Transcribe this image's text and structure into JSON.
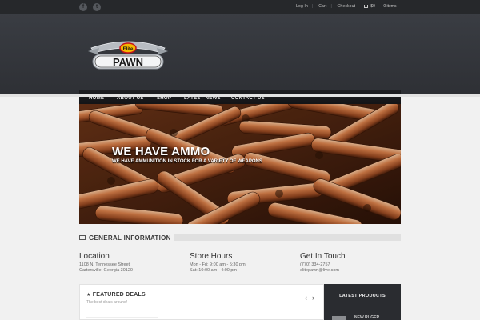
{
  "topbar": {
    "social": [
      {
        "name": "facebook-icon",
        "glyph": "f"
      },
      {
        "name": "twitter-icon",
        "glyph": "t"
      }
    ],
    "links": [
      "Log In",
      "Cart",
      "Checkout"
    ],
    "cart_total": "$0",
    "cart_items": "0 items"
  },
  "logo": {
    "badge": "Elite",
    "wordmark": "PAWN"
  },
  "nav": [
    "HOME",
    "ABOUT US",
    "SHOP",
    "LATEST NEWS",
    "CONTACT US"
  ],
  "hero": {
    "title": "WE HAVE AMMO",
    "subtitle": "WE HAVE AMMUNITION IN STOCK FOR A VARIETY OF WEAPONS"
  },
  "general_info": {
    "title": "GENERAL INFORMATION"
  },
  "location": {
    "heading": "Location",
    "line1": "1108 N. Tennessee Street",
    "line2": "Cartersville, Georgia 30120"
  },
  "hours": {
    "heading": "Store Hours",
    "line1": "Mon - Fri: 9:00 am - 5:30 pm",
    "line2": "Sat: 10:00 am - 4:00 pm"
  },
  "contact": {
    "heading": "Get In Touch",
    "phone": "(770) 334-2757",
    "email": "elitepawn@live.com"
  },
  "featured": {
    "title": "FEATURED DEALS",
    "subtitle": "The best deals around!",
    "prev": "‹",
    "next": "›"
  },
  "latest": {
    "title": "LATEST PRODUCTS",
    "item": "NEW RUGER"
  }
}
